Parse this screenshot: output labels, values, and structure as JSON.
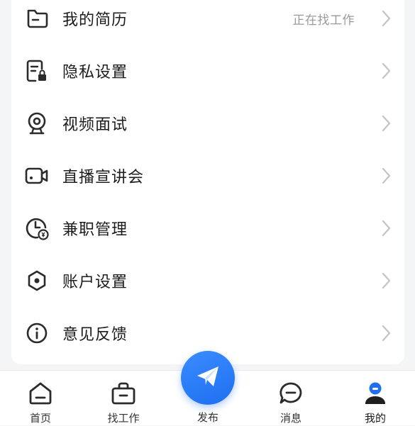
{
  "menu": {
    "items": [
      {
        "label": "我的简历",
        "hint": "正在找工作",
        "icon": "folder-icon"
      },
      {
        "label": "隐私设置",
        "icon": "document-lock-icon"
      },
      {
        "label": "视频面试",
        "icon": "webcam-icon"
      },
      {
        "label": "直播宣讲会",
        "icon": "video-camera-icon"
      },
      {
        "label": "兼职管理",
        "icon": "clock-money-icon"
      },
      {
        "label": "账户设置",
        "icon": "hexagon-settings-icon"
      },
      {
        "label": "意见反馈",
        "icon": "info-icon"
      }
    ]
  },
  "tabbar": {
    "home": "首页",
    "jobs": "找工作",
    "publish": "发布",
    "messages": "消息",
    "mine": "我的"
  },
  "colors": {
    "accent": "#1f6ff0",
    "icon": "#2b2b2b",
    "chevron": "#c4c4c4"
  }
}
